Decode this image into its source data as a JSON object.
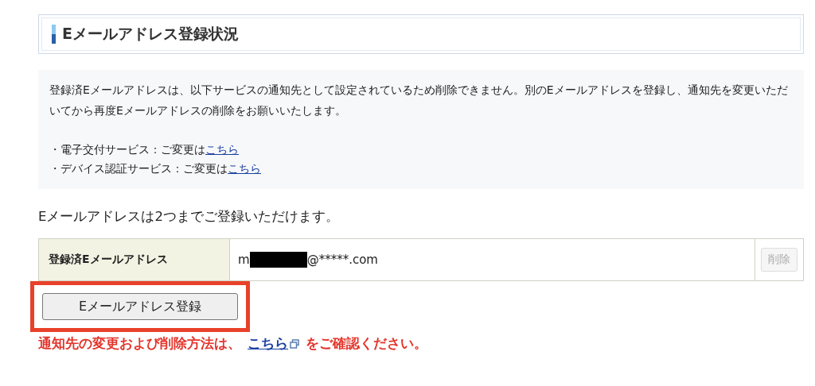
{
  "heading": "Eメールアドレス登録状況",
  "notice": {
    "message": "登録済Eメールアドレスは、以下サービスの通知先として設定されているため削除できません。別のEメールアドレスを登録し、通知先を変更いただいてから再度Eメールアドレスの削除をお願いいたします。",
    "items": [
      {
        "text": "・電子交付サービス：ご変更は",
        "link": "こちら"
      },
      {
        "text": "・デバイス認証サービス：ご変更は",
        "link": "こちら"
      }
    ]
  },
  "limit_text": "Eメールアドレスは2つまでご登録いただけます。",
  "table": {
    "label": "登録済Eメールアドレス",
    "email_start": "m",
    "email_end": "@*****.com",
    "redacted": true,
    "delete_button": {
      "label": "削除",
      "disabled": true
    }
  },
  "register_button": {
    "label": "Eメールアドレス登録",
    "highlighted": true
  },
  "footer": {
    "before": "通知先の変更および削除方法は、",
    "link": "こちら",
    "after": "をご確認ください。"
  }
}
